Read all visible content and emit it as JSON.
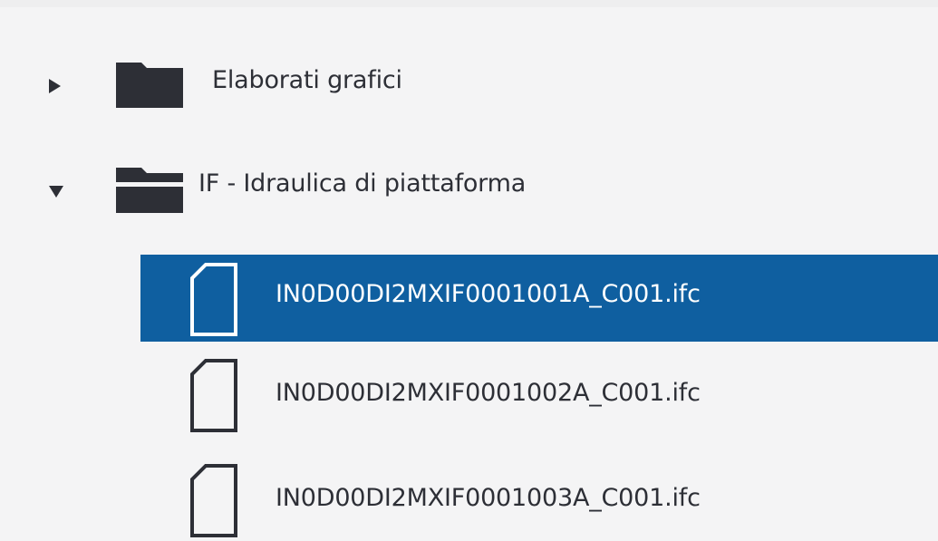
{
  "tree": {
    "folders": [
      {
        "label": "Elaborati grafici",
        "expanded": false,
        "icon": "folder-closed-icon"
      },
      {
        "label": "IF - Idraulica di piattaforma",
        "expanded": true,
        "icon": "folder-open-icon"
      }
    ],
    "files": [
      {
        "label": "IN0D00DI2MXIF0001001A_C001.ifc",
        "selected": true,
        "icon": "file-icon"
      },
      {
        "label": "IN0D00DI2MXIF0001002A_C001.ifc",
        "selected": false,
        "icon": "file-icon"
      },
      {
        "label": "IN0D00DI2MXIF0001003A_C001.ifc",
        "selected": false,
        "icon": "file-icon"
      }
    ]
  },
  "colors": {
    "background": "#f4f4f5",
    "selection": "#0f5fa0",
    "text": "#2d2f36",
    "selected_text": "#ffffff"
  }
}
